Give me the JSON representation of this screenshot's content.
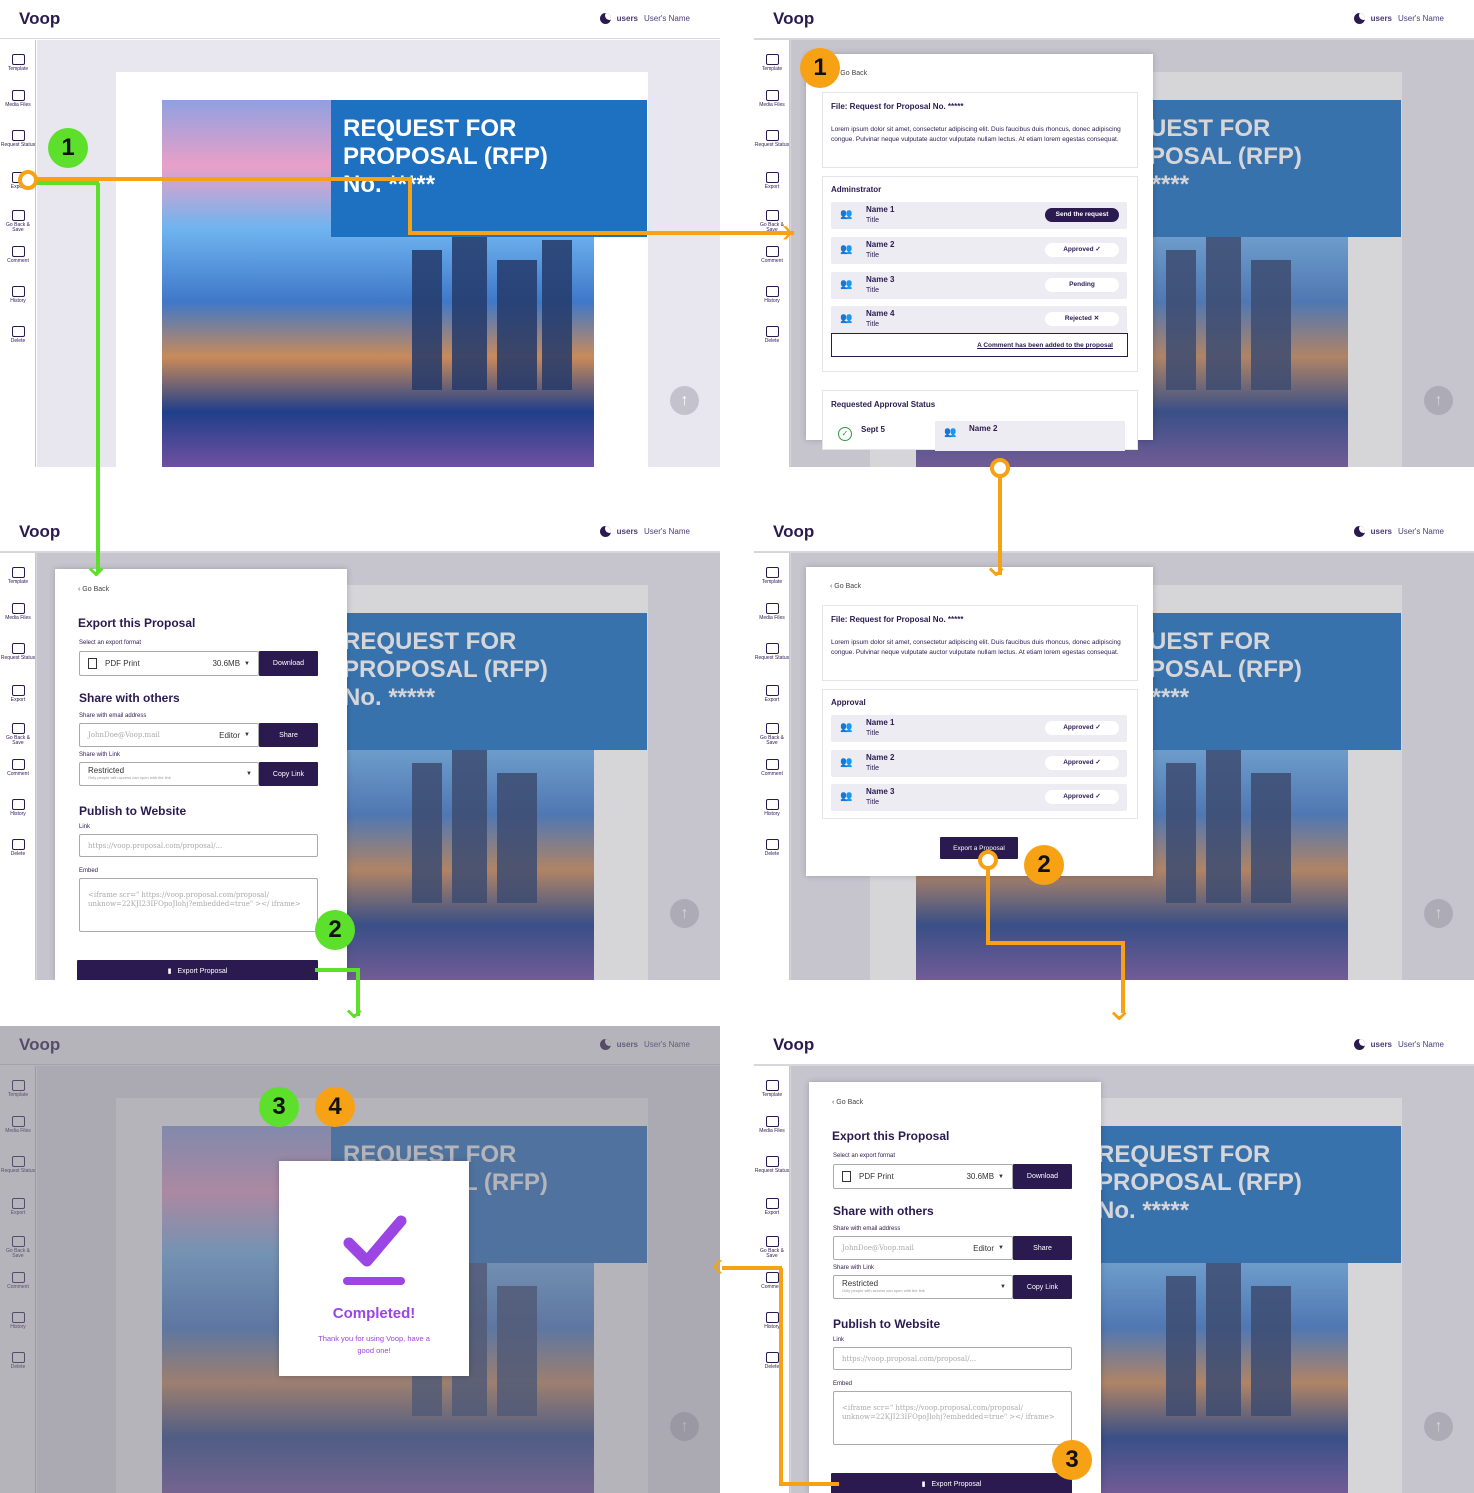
{
  "app": {
    "logo": "Voop",
    "user_prefix": "users",
    "user_name": "User's Name"
  },
  "sidebar": [
    "Template",
    "Media Files",
    "Request Status",
    "Export",
    "Go Back & Save",
    "Comment",
    "History",
    "Delete"
  ],
  "cover": {
    "title": "REQUEST FOR\nPROPOSAL (RFP)\nNo. *****"
  },
  "badges": [
    "1",
    "2",
    "3",
    "4"
  ],
  "go_back": "Go Back",
  "request": {
    "file_title": "File: Request for Proposal No. *****",
    "lorem": "Lorem ipsum dolor sit amet, consectetur adipiscing elit. Duis faucibus duis rhoncus, donec adipiscing congue. Pulvinar neque vulputate auctor vulputate nullam lectus. At etiam lorem egestas consequat.",
    "admin_title": "Adminstrator",
    "admins": [
      {
        "name": "Name 1",
        "title": "Title",
        "status": "Send the request"
      },
      {
        "name": "Name 2",
        "title": "Title",
        "status": "Approved ✓"
      },
      {
        "name": "Name 3",
        "title": "Title",
        "status": "Pending"
      },
      {
        "name": "Name 4",
        "title": "Title",
        "status": "Rejected  ✕"
      }
    ],
    "comment_note": "A Comment has been added to the proposal",
    "status_title": "Requested Approval Status",
    "status_date": "Sept 5",
    "status_name": "Name 2"
  },
  "approval": {
    "title": "Approval",
    "rows": [
      {
        "name": "Name 1",
        "title": "Title",
        "status": "Approved ✓"
      },
      {
        "name": "Name 2",
        "title": "Title",
        "status": "Approved ✓"
      },
      {
        "name": "Name 3",
        "title": "Title",
        "status": "Approved ✓"
      }
    ],
    "export_btn": "Export a Proposal"
  },
  "export": {
    "title": "Export this Proposal",
    "format_label": "Select an export format",
    "format": "PDF Print",
    "size": "30.6MB",
    "download": "Download",
    "share_title": "Share with others",
    "email_label": "Share with email address",
    "email_placeholder": "JohnDoe@Voop.mail",
    "role": "Editor",
    "share_btn": "Share",
    "link_label": "Share with Link",
    "link_mode": "Restricted",
    "link_mode_sub": "Only people with access can open with the link",
    "copy_btn": "Copy Link",
    "publish_title": "Publish to Website",
    "link_field_label": "Link",
    "link_placeholder": "https://voop.proposal.com/proposal/...",
    "embed_label": "Embed",
    "embed_placeholder": "<iframe scr=\" https://voop.proposal.com/proposal/ unknow=22KJI23IFOpoJlohj?embedded=true\" ></ iframe>",
    "export_btn": "Export Proposal"
  },
  "completed": {
    "title": "Completed!",
    "message": "Thank you for using Voop, have a good one!"
  },
  "colors": {
    "brand": "#2a1a4f",
    "accent_green": "#5de02c",
    "accent_orange": "#f7a114",
    "cover_blue": "#1e70c0",
    "completed_purple": "#9b45e4"
  }
}
